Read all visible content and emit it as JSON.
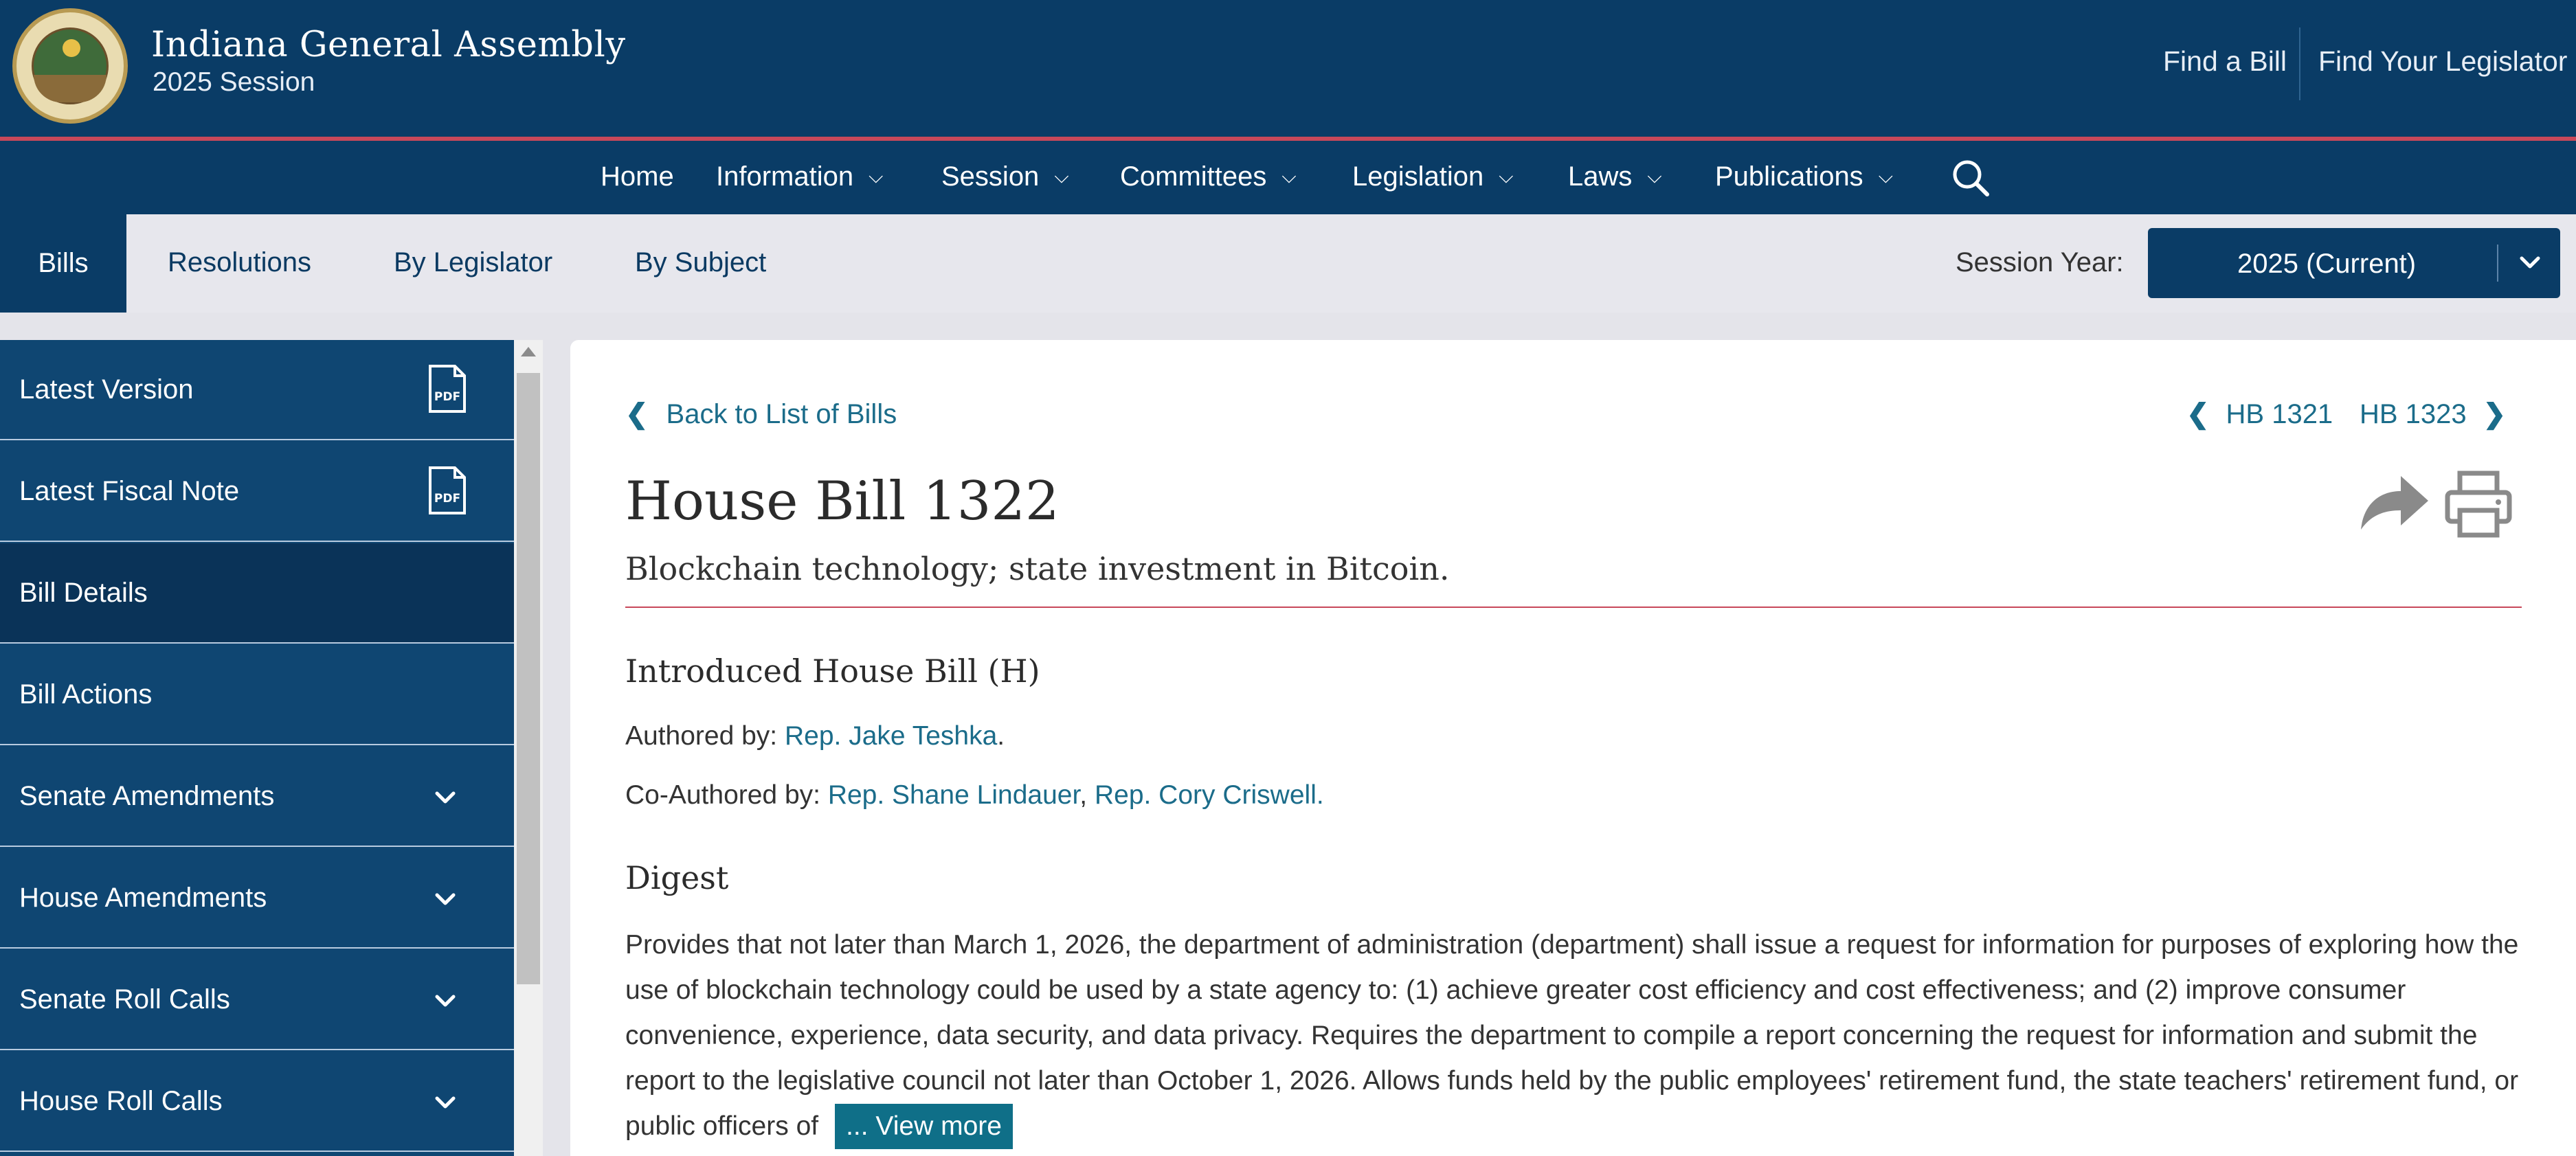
{
  "header": {
    "title": "Indiana General Assembly",
    "subtitle": "2025 Session",
    "links": [
      "Find a Bill",
      "Find Your Legislator"
    ]
  },
  "main_nav": {
    "items": [
      {
        "label": "Home",
        "has_dropdown": false
      },
      {
        "label": "Information",
        "has_dropdown": true
      },
      {
        "label": "Session",
        "has_dropdown": true
      },
      {
        "label": "Committees",
        "has_dropdown": true
      },
      {
        "label": "Legislation",
        "has_dropdown": true
      },
      {
        "label": "Laws",
        "has_dropdown": true
      },
      {
        "label": "Publications",
        "has_dropdown": true
      }
    ],
    "search_icon": "search-icon"
  },
  "sub_nav": {
    "tabs": [
      "Bills",
      "Resolutions",
      "By Legislator",
      "By Subject"
    ],
    "active_tab": "Bills",
    "session_label": "Session Year:",
    "session_value": "2025 (Current)"
  },
  "sidebar": {
    "items": [
      {
        "label": "Latest Version",
        "icon": "pdf-icon"
      },
      {
        "label": "Latest Fiscal Note",
        "icon": "pdf-icon"
      },
      {
        "label": "Bill Details",
        "active": true
      },
      {
        "label": "Bill Actions"
      },
      {
        "label": "Senate Amendments",
        "icon": "chevron-down-icon"
      },
      {
        "label": "House Amendments",
        "icon": "chevron-down-icon"
      },
      {
        "label": "Senate Roll Calls",
        "icon": "chevron-down-icon"
      },
      {
        "label": "House Roll Calls",
        "icon": "chevron-down-icon"
      }
    ]
  },
  "bill": {
    "back_label": "Back to List of Bills",
    "prev_label": "HB 1321",
    "next_label": "HB 1323",
    "title": "House Bill 1322",
    "subtitle": "Blockchain technology; state investment in Bitcoin.",
    "version_heading": "Introduced House Bill (H)",
    "authored_prefix": "Authored by: ",
    "author": "Rep. Jake Teshka",
    "coauthored_prefix": "Co-Authored by: ",
    "coauthors": [
      "Rep. Shane Lindauer",
      "Rep. Cory Criswell"
    ],
    "digest_heading": "Digest",
    "digest_text": "Provides that not later than March 1, 2026, the department of administration (department) shall issue a request for information for purposes of exploring how the use of blockchain technology could be used by a state agency to: (1) achieve greater cost efficiency and cost effectiveness; and (2) improve consumer convenience, experience, data security, and data privacy. Requires the department to compile a report concerning the request for information and submit the report to the legislative council not later than October 1, 2026. Allows funds held by the public employees' retirement fund, the state teachers' retirement fund, or public officers of",
    "view_more_label": "... View more"
  },
  "colors": {
    "primary_navy": "#0a3c66",
    "sidebar_blue": "#0f4672",
    "accent_red": "#c8485a",
    "link_teal": "#1b6c8a",
    "button_teal": "#0f6f88"
  }
}
